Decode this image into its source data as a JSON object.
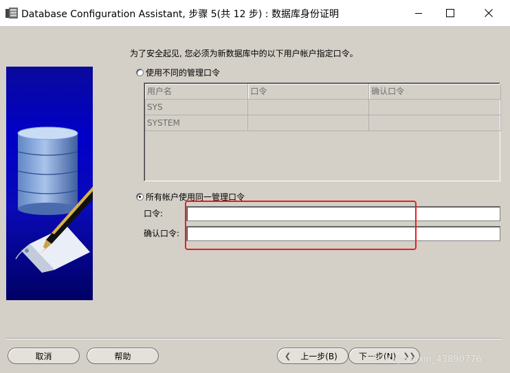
{
  "window": {
    "title": "Database Configuration Assistant, 步骤 5(共 12 步) : 数据库身份证明",
    "controls": [
      "minimize-icon",
      "maximize-icon",
      "close-icon"
    ]
  },
  "main": {
    "prompt": "为了安全起见, 您必须为新数据库中的以下用户帐户指定口令。",
    "option_different": "使用不同的管理口令",
    "option_same": "所有帐户使用同一管理口令",
    "table": {
      "columns": [
        "用户名",
        "口令",
        "确认口令"
      ],
      "rows": [
        [
          "SYS",
          "",
          ""
        ],
        [
          "SYSTEM",
          "",
          ""
        ]
      ]
    },
    "password_label": "口令:",
    "confirm_label": "确认口令:",
    "password_value": "",
    "confirm_value": ""
  },
  "buttons": {
    "cancel": "取消",
    "help": "帮助",
    "back": "上一步(B)",
    "next": "下一步(N)"
  },
  "watermark": "CSDN @weixin_43890776",
  "colors": {
    "highlight": "#ee1b1b",
    "dialog_bg": "#d4d0c8",
    "graphic_bg": "#0000c8"
  }
}
